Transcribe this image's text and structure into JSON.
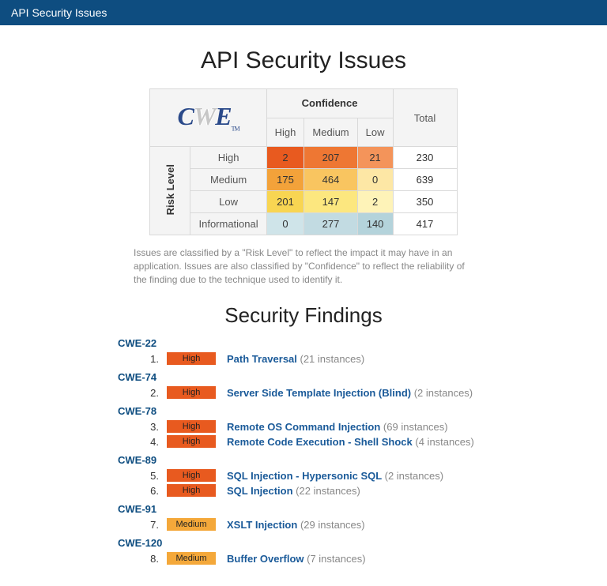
{
  "topbar": {
    "title": "API Security Issues"
  },
  "page": {
    "title": "API Security Issues"
  },
  "logo": {
    "c": "C",
    "w": "W",
    "e": "E",
    "tm": "TM"
  },
  "matrix": {
    "confidence_label": "Confidence",
    "risk_label": "Risk Level",
    "col_high": "High",
    "col_medium": "Medium",
    "col_low": "Low",
    "col_total": "Total",
    "rows": [
      {
        "label": "High",
        "high": "2",
        "medium": "207",
        "low": "21",
        "total": "230",
        "clr": {
          "h": "#e85a1f",
          "m": "#ee7733",
          "l": "#f4945a"
        }
      },
      {
        "label": "Medium",
        "high": "175",
        "medium": "464",
        "low": "0",
        "total": "639",
        "clr": {
          "h": "#f3a23a",
          "m": "#f9c560",
          "l": "#fde7a5"
        }
      },
      {
        "label": "Low",
        "high": "201",
        "medium": "147",
        "low": "2",
        "total": "350",
        "clr": {
          "h": "#f8d552",
          "m": "#fce77f",
          "l": "#fef3b8"
        }
      },
      {
        "label": "Informational",
        "high": "0",
        "medium": "277",
        "low": "140",
        "total": "417",
        "clr": {
          "h": "#cfe4e9",
          "m": "#c2dbe2",
          "l": "#b4d3db"
        }
      }
    ]
  },
  "caption": "Issues are classified by a \"Risk Level\" to reflect the impact it may have in an application. Issues are also classified by \"Confidence\" to reflect the reliability of the finding due to the technique used to identify it.",
  "section": {
    "findings": "Security Findings"
  },
  "sev_labels": {
    "high": "High",
    "medium": "Medium"
  },
  "findings": [
    {
      "cwe": "CWE-22",
      "items": [
        {
          "idx": "1.",
          "sev": "high",
          "title": "Path Traversal",
          "count": "(21 instances)"
        }
      ]
    },
    {
      "cwe": "CWE-74",
      "items": [
        {
          "idx": "2.",
          "sev": "high",
          "title": "Server Side Template Injection (Blind)",
          "count": "(2 instances)"
        }
      ]
    },
    {
      "cwe": "CWE-78",
      "items": [
        {
          "idx": "3.",
          "sev": "high",
          "title": "Remote OS Command Injection",
          "count": "(69 instances)"
        },
        {
          "idx": "4.",
          "sev": "high",
          "title": "Remote Code Execution - Shell Shock",
          "count": "(4 instances)"
        }
      ]
    },
    {
      "cwe": "CWE-89",
      "items": [
        {
          "idx": "5.",
          "sev": "high",
          "title": "SQL Injection - Hypersonic SQL",
          "count": "(2 instances)"
        },
        {
          "idx": "6.",
          "sev": "high",
          "title": "SQL Injection",
          "count": "(22 instances)"
        }
      ]
    },
    {
      "cwe": "CWE-91",
      "items": [
        {
          "idx": "7.",
          "sev": "medium",
          "title": "XSLT Injection",
          "count": "(29 instances)"
        }
      ]
    },
    {
      "cwe": "CWE-120",
      "items": [
        {
          "idx": "8.",
          "sev": "medium",
          "title": "Buffer Overflow",
          "count": "(7 instances)"
        }
      ]
    }
  ],
  "chart_data": {
    "type": "heatmap",
    "title": "API Security Issues",
    "xlabel": "Confidence",
    "ylabel": "Risk Level",
    "x_categories": [
      "High",
      "Medium",
      "Low"
    ],
    "y_categories": [
      "High",
      "Medium",
      "Low",
      "Informational"
    ],
    "values": [
      [
        2,
        207,
        21
      ],
      [
        175,
        464,
        0
      ],
      [
        201,
        147,
        2
      ],
      [
        0,
        277,
        140
      ]
    ],
    "row_totals": [
      230,
      639,
      350,
      417
    ]
  }
}
